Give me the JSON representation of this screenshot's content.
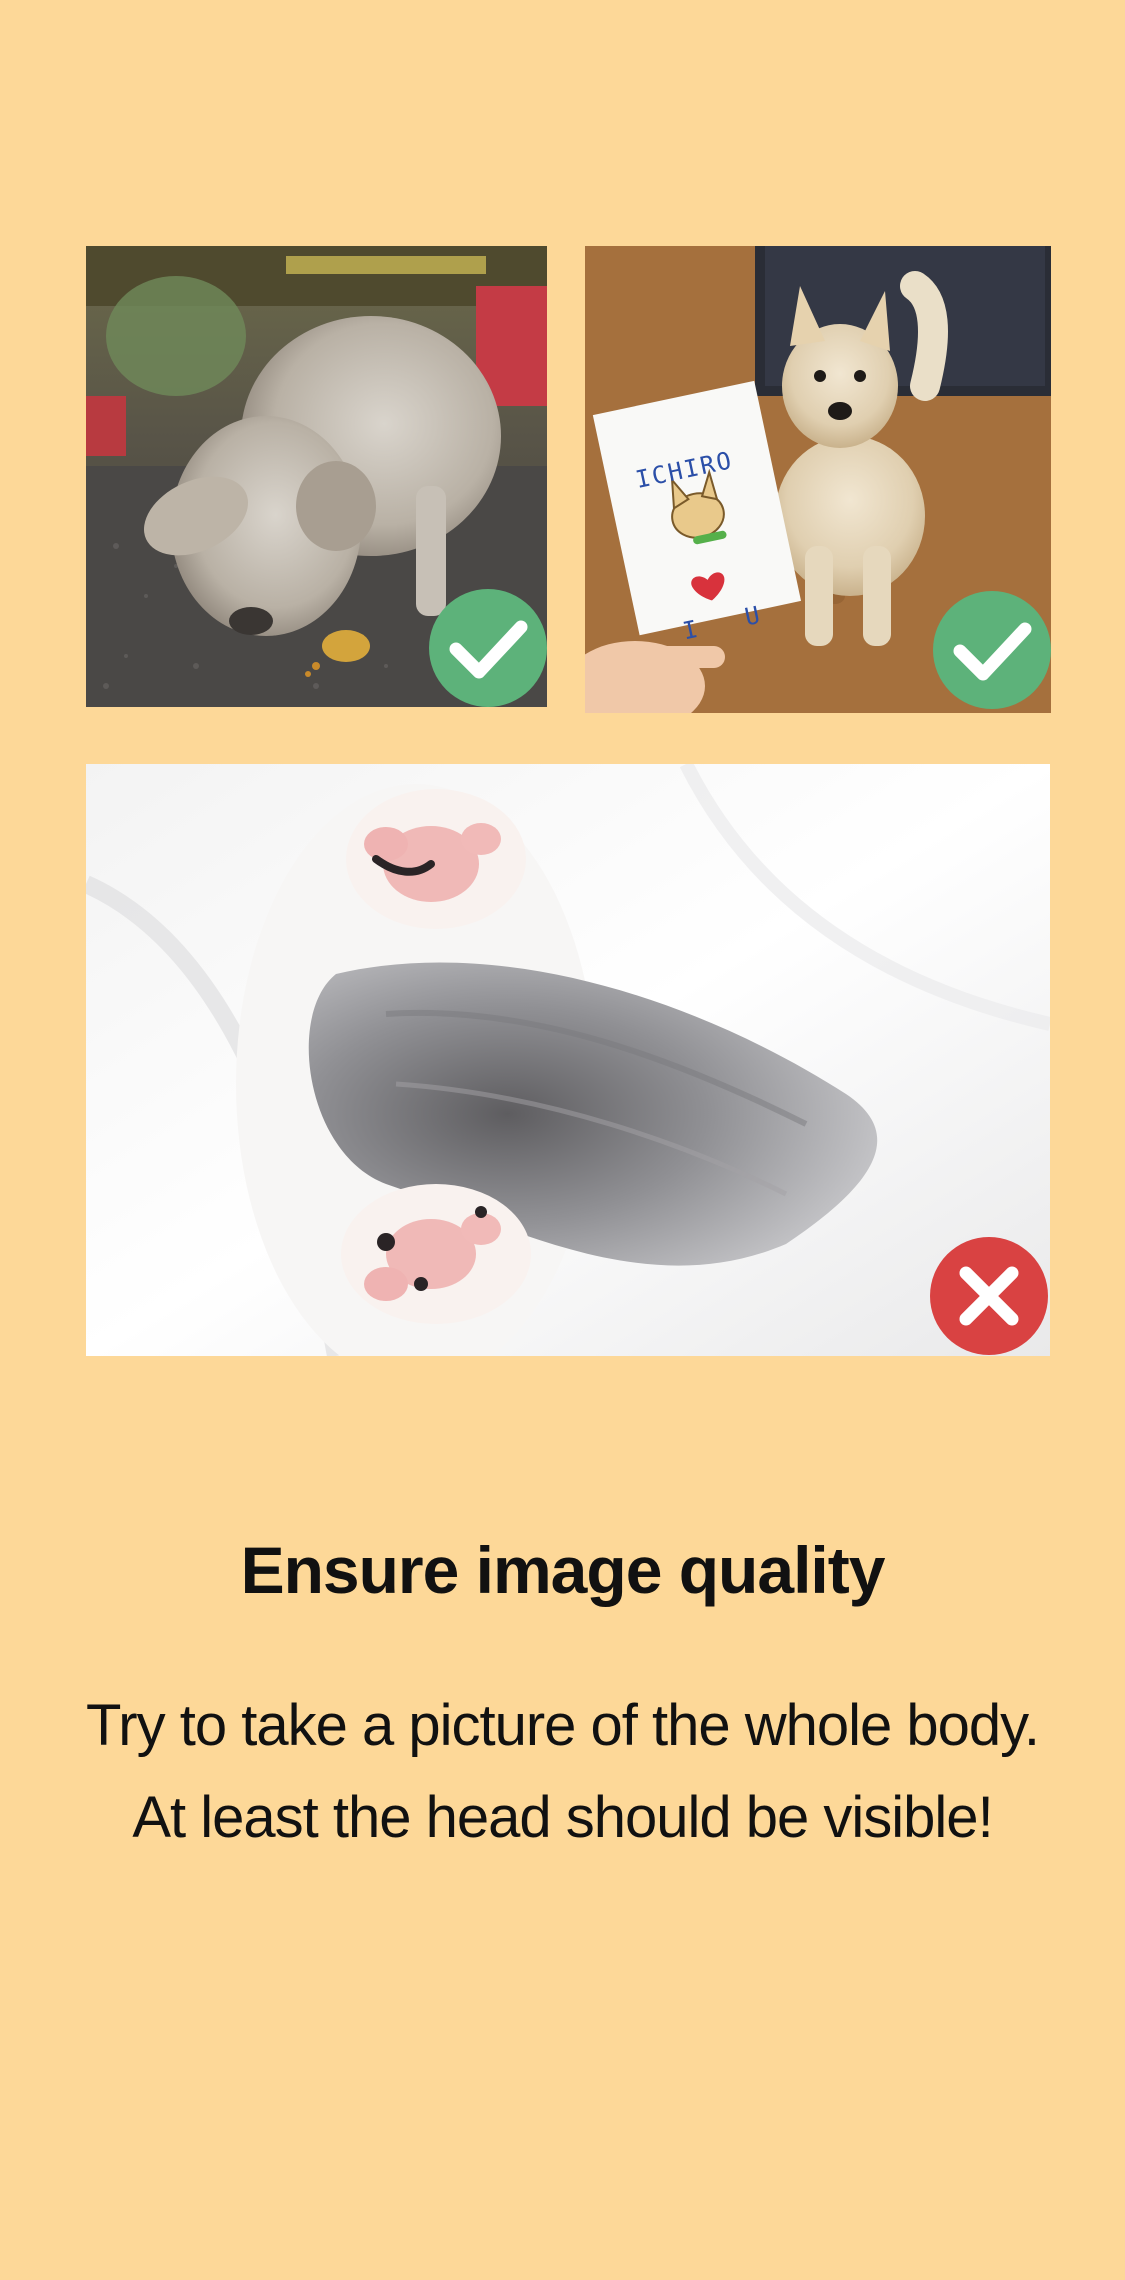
{
  "examples": [
    {
      "status": "good",
      "badge_icon": "check-icon",
      "badge_color": "#5DB27A"
    },
    {
      "status": "good",
      "badge_icon": "check-icon",
      "badge_color": "#5DB27A",
      "card": {
        "name": "ICHIRO",
        "message_left": "I",
        "message_right": "U"
      }
    },
    {
      "status": "bad",
      "badge_icon": "x-icon",
      "badge_color": "#D94242"
    }
  ],
  "heading": "Ensure image quality",
  "body": {
    "line1": "Try to take a picture of the whole body.",
    "line2": "At least the head should be visible!"
  },
  "colors": {
    "background": "#FDD898",
    "good": "#5DB27A",
    "bad": "#D94242",
    "text": "#111111"
  }
}
